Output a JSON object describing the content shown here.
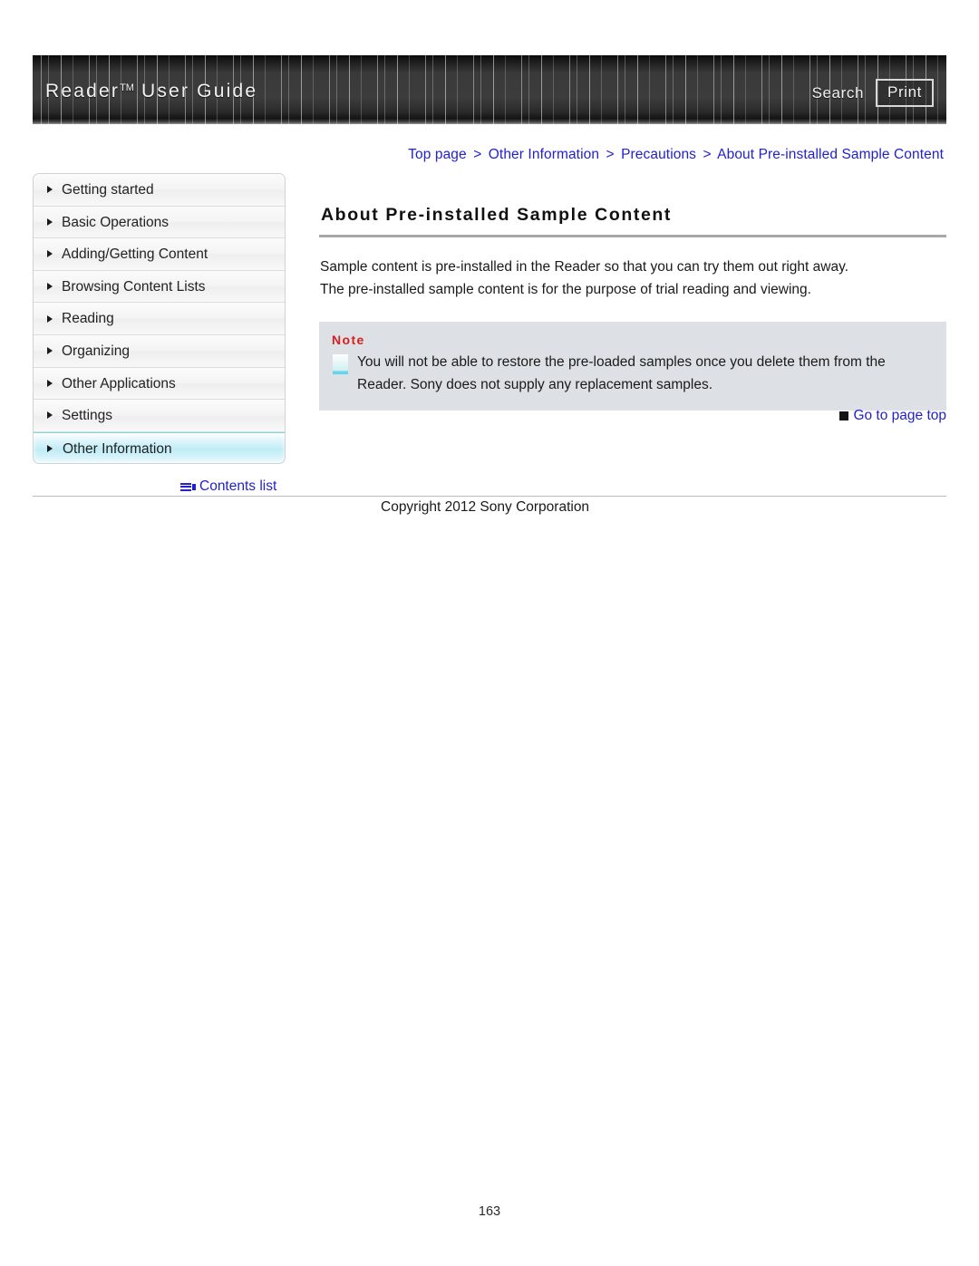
{
  "header": {
    "title_main": "Reader",
    "title_tm": "TM",
    "title_rest": " User Guide",
    "search_label": "Search",
    "print_label": "Print"
  },
  "breadcrumb": {
    "separator": ">",
    "items": [
      {
        "label": "Top page"
      },
      {
        "label": "Other Information"
      },
      {
        "label": "Precautions"
      },
      {
        "label": "About Pre-installed Sample Content"
      }
    ]
  },
  "sidebar": {
    "items": [
      {
        "label": "Getting started",
        "active": false
      },
      {
        "label": "Basic Operations",
        "active": false
      },
      {
        "label": "Adding/Getting Content",
        "active": false
      },
      {
        "label": "Browsing Content Lists",
        "active": false
      },
      {
        "label": "Reading",
        "active": false
      },
      {
        "label": "Organizing",
        "active": false
      },
      {
        "label": "Other Applications",
        "active": false
      },
      {
        "label": "Settings",
        "active": false
      },
      {
        "label": "Other Information",
        "active": true
      }
    ],
    "contents_list_label": "Contents list"
  },
  "main": {
    "title": "About Pre-installed Sample Content",
    "paragraphs": [
      "Sample content is pre-installed in the Reader so that you can try them out right away.",
      "The pre-installed sample content is for the purpose of trial reading and viewing."
    ],
    "note": {
      "label": "Note",
      "text": "You will not be able to restore the pre-loaded samples once you delete them from the Reader. Sony does not supply any replacement samples."
    },
    "page_top_label": "Go to page top"
  },
  "footer": {
    "copyright": "Copyright 2012 Sony Corporation",
    "page_number": "163"
  },
  "colors": {
    "link": "#2222cc",
    "note_label": "#d42020",
    "note_bg": "#dde1e5",
    "active_nav": "#bfecf6",
    "header_bg": "#3c3c3c"
  }
}
